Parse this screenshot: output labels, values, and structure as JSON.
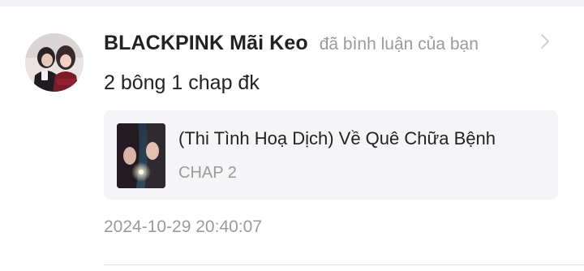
{
  "notification": {
    "username": "BLACKPINK Mãi Keo",
    "action_text": "đã bình luận của bạn",
    "comment_text": "2 bông 1 chap đk",
    "reference": {
      "title": "(Thi Tình Hoạ Dịch) Về Quê Chữa Bệnh",
      "subtitle": "CHAP 2"
    },
    "timestamp": "2024-10-29 20:40:07"
  },
  "icons": {
    "avatar": "user-avatar-photo",
    "thumbnail": "manga-cover-thumbnail",
    "chevron": "chevron-right-icon"
  },
  "colors": {
    "primary_text": "#222222",
    "secondary_text": "#9a9a9a",
    "reference_background": "#f5f5f7",
    "top_strip": "#f3f3f5"
  }
}
